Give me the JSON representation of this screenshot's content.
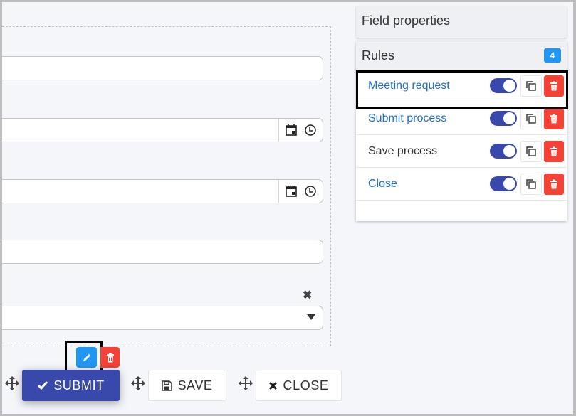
{
  "form": {
    "fields": [
      {
        "type": "text",
        "value": ""
      },
      {
        "type": "datetime",
        "value": "",
        "icons": [
          "calendar-icon",
          "clock-icon"
        ]
      },
      {
        "type": "datetime",
        "value": "",
        "icons": [
          "calendar-icon",
          "clock-icon"
        ]
      },
      {
        "type": "text",
        "value": ""
      },
      {
        "type": "select",
        "selected": "",
        "clear_icon": "close-icon",
        "caret_icon": "caret-down-icon"
      }
    ],
    "field_toolbar": {
      "edit_icon": "pencil-icon",
      "delete_icon": "trash-icon"
    }
  },
  "buttons": {
    "submit": {
      "label": "SUBMIT",
      "icon": "check-icon",
      "color": "#3949ab"
    },
    "save": {
      "label": "SAVE",
      "icon": "floppy-disk-icon"
    },
    "close": {
      "label": "CLOSE",
      "icon": "x-icon"
    }
  },
  "side_panel": {
    "field_properties_title": "Field properties",
    "rules": {
      "title": "Rules",
      "count": "4",
      "items": [
        {
          "label": "Meeting request",
          "enabled": true,
          "style": "link"
        },
        {
          "label": "Submit process",
          "enabled": true,
          "style": "link"
        },
        {
          "label": "Save process",
          "enabled": true,
          "style": "plain"
        },
        {
          "label": "Close",
          "enabled": true,
          "style": "link"
        }
      ]
    }
  },
  "colors": {
    "primary": "#3949ab",
    "info": "#2196f3",
    "danger": "#f44336",
    "link": "#1e6fc9"
  }
}
